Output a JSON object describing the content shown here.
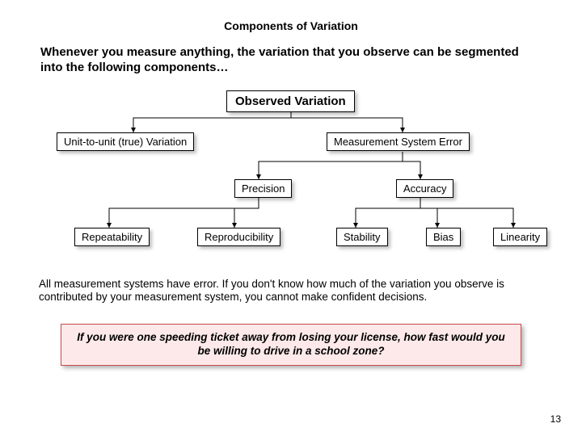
{
  "title": "Components of Variation",
  "intro": "Whenever you measure anything, the variation that you observe can be segmented into the following components…",
  "nodes": {
    "observed": "Observed Variation",
    "unit": "Unit-to-unit (true) Variation",
    "mse": "Measurement System Error",
    "precision": "Precision",
    "accuracy": "Accuracy",
    "repeat": "Repeatability",
    "repro": "Reproducibility",
    "stability": "Stability",
    "bias": "Bias",
    "linearity": "Linearity"
  },
  "body": "All measurement systems have error.  If you don't know how much of the variation you observe is contributed by your measurement system, you cannot make confident decisions.",
  "callout": "If you were one speeding ticket away from losing your license, how fast would you be willing to drive in a school zone?",
  "page": "13"
}
